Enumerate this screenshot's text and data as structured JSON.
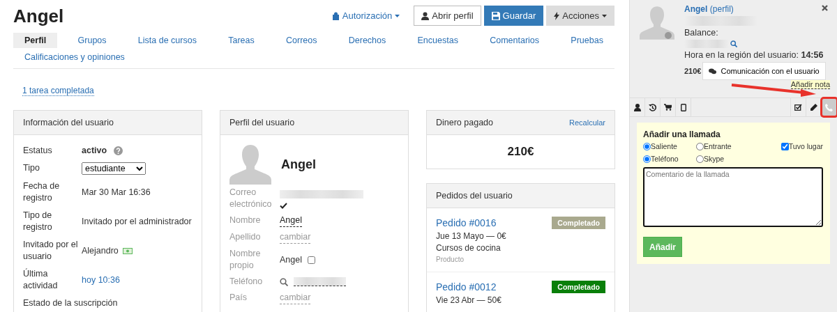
{
  "header": {
    "title": "Angel",
    "buttons": [
      {
        "kind": "link",
        "label": "Autorización"
      },
      {
        "kind": "default",
        "label": "Abrir perfil"
      },
      {
        "kind": "primary",
        "label": "Guardar"
      },
      {
        "kind": "dropdown",
        "label": "Acciones"
      }
    ]
  },
  "tabs": [
    {
      "label": "Perfil",
      "selected": true
    },
    {
      "label": "Grupos",
      "selected": false
    },
    {
      "label": "Lista de cursos",
      "selected": false
    },
    {
      "label": "Tareas",
      "selected": false
    },
    {
      "label": "Correos",
      "selected": false
    },
    {
      "label": "Derechos",
      "selected": false
    },
    {
      "label": "Encuestas",
      "selected": false
    },
    {
      "label": "Comentarios",
      "selected": false
    },
    {
      "label": "Pruebas",
      "selected": false
    },
    {
      "label": "Calificaciones y opiniones",
      "selected": false
    }
  ],
  "task_link": "1 tarea completada",
  "user_info": {
    "title": "Información del usuario",
    "rows": [
      {
        "kind": "status",
        "label": "Estatus",
        "value": "activo"
      },
      {
        "kind": "select",
        "label": "Tipo",
        "value": "estudiante"
      },
      {
        "kind": "text",
        "label": "Fecha de registro",
        "value": "Mar 30 Mar 16:36"
      },
      {
        "kind": "text",
        "label": "Tipo de registro",
        "value": "Invitado por el administrador"
      },
      {
        "kind": "user",
        "label": "Invitado por el usuario",
        "value": "Alejandro"
      },
      {
        "kind": "link",
        "label": "Última actividad",
        "value": "hoy 10:36"
      },
      {
        "kind": "heading",
        "label": "Estado de la suscripción"
      }
    ]
  },
  "profile": {
    "title": "Perfil del usuario",
    "name": "Angel",
    "rows": [
      {
        "kind": "email",
        "label": "Correo electrónico",
        "verified": true
      },
      {
        "kind": "editable",
        "label": "Nombre",
        "value": "Angel"
      },
      {
        "kind": "change",
        "label": "Apellido",
        "value": "cambiar"
      },
      {
        "kind": "checkbox",
        "label": "Nombre propio",
        "value": "Angel",
        "checked": false
      },
      {
        "kind": "phone",
        "label": "Teléfono"
      },
      {
        "kind": "change",
        "label": "País",
        "value": "cambiar"
      }
    ]
  },
  "money": {
    "title": "Dinero pagado",
    "action": "Recalcular",
    "amount": "210€"
  },
  "orders": {
    "title": "Pedidos del usuario",
    "items": [
      {
        "number": "Pedido #0016",
        "date": "Jue 13 Mayo — 0€",
        "product": "Cursos de cocina",
        "type": "Producto",
        "status": "Completado",
        "active": false
      },
      {
        "number": "Pedido #0012",
        "date": "Vie 23 Abr — 50€",
        "status": "Completado",
        "active": true
      }
    ]
  },
  "sidebar": {
    "name": "Angel",
    "profile_link": "(perfil)",
    "online": false,
    "balance_label": "Balance:",
    "time_label": "Hora en la región del usuario:",
    "time": "14:56",
    "amount": "210€",
    "communication_button": "Comunicación con el usuario",
    "add_note": "Añadir nota",
    "tools": [
      {
        "kind": "user",
        "selected": false,
        "highlighted": false
      },
      {
        "kind": "history",
        "selected": false,
        "highlighted": false
      },
      {
        "kind": "cart",
        "selected": false,
        "highlighted": false
      },
      {
        "kind": "tablet",
        "selected": false,
        "highlighted": false
      },
      {
        "kind": "task",
        "selected": false,
        "highlighted": false
      },
      {
        "kind": "pencil",
        "selected": false,
        "highlighted": false
      },
      {
        "kind": "phone",
        "selected": true,
        "highlighted": true
      }
    ],
    "call_form": {
      "title": "Añadir una llamada",
      "direction": [
        {
          "label": "Saliente",
          "selected": true
        },
        {
          "label": "Entrante",
          "selected": false
        }
      ],
      "took_place": {
        "label": "Tuvo lugar",
        "checked": true
      },
      "channel": [
        {
          "label": "Teléfono",
          "selected": true
        },
        {
          "label": "Skype",
          "selected": false
        }
      ],
      "comment_placeholder": "Comentario de la llamada",
      "submit": "Añadir"
    }
  }
}
